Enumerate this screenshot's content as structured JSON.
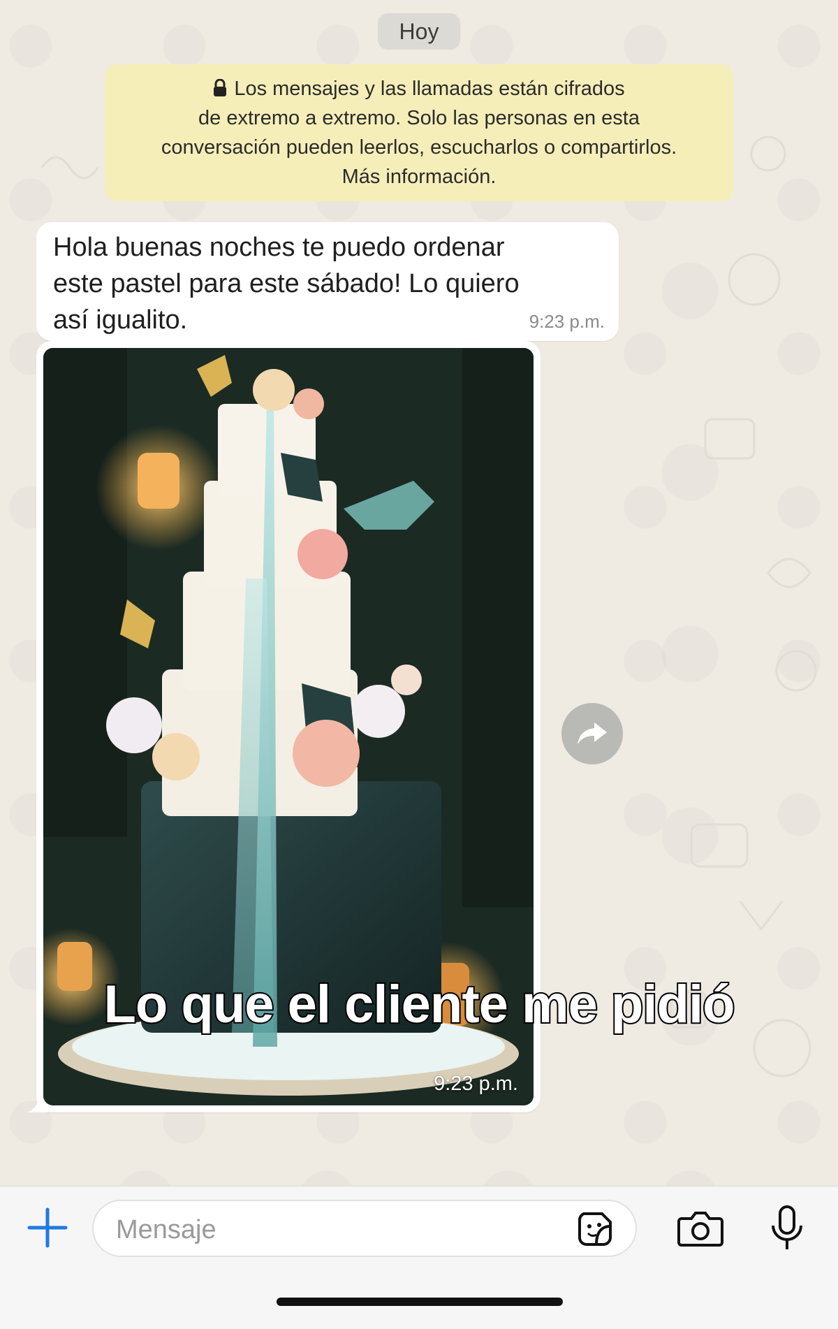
{
  "chat": {
    "date_label": "Hoy",
    "e2e_notice": "Los mensajes y las llamadas están cifrados de extremo a extremo. Solo las personas en esta conversación pueden leerlos, escucharlos o compartirlos. Más información.",
    "e2e_line1": "Los mensajes y las llamadas están cifrados",
    "e2e_line2": "de extremo a extremo. Solo las personas en esta",
    "e2e_line3": "conversación pueden leerlos, escucharlos o compartirlos.",
    "e2e_line4": "Más información.",
    "messages": [
      {
        "type": "text",
        "text": "Hola buenas noches te puedo ordenar este pastel para este sábado! Lo quiero así igualito.",
        "line1": "Hola buenas noches te puedo ordenar",
        "line2": "este pastel para este sábado! Lo quiero",
        "line3": "así igualito.",
        "time": "9:23 p.m."
      },
      {
        "type": "image",
        "time": "9:23 p.m."
      }
    ]
  },
  "overlay_caption": "Lo que el cliente me pidió",
  "composer": {
    "placeholder": "Mensaje"
  },
  "icons": {
    "lock": "lock-icon",
    "forward": "forward-icon",
    "plus": "plus-icon",
    "sticker": "sticker-icon",
    "camera": "camera-icon",
    "mic": "microphone-icon"
  },
  "colors": {
    "chat_background": "#efeae2",
    "notice_background": "#f6eeb9",
    "bubble_incoming": "#ffffff",
    "accent_blue": "#1f7ae0"
  }
}
